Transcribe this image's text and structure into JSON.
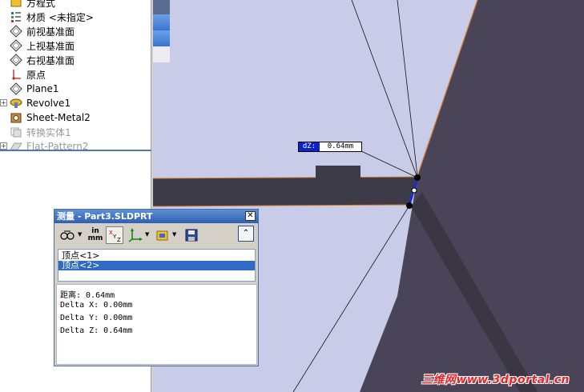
{
  "feature_tree": {
    "items": [
      {
        "label": "方程式",
        "icon": "equation-folder-icon",
        "expander": false,
        "dim": false
      },
      {
        "label": "材质 <未指定>",
        "icon": "material-icon",
        "expander": false,
        "dim": false
      },
      {
        "label": "前视基准面",
        "icon": "plane-icon",
        "expander": false,
        "dim": false
      },
      {
        "label": "上视基准面",
        "icon": "plane-icon",
        "expander": false,
        "dim": false
      },
      {
        "label": "右视基准面",
        "icon": "plane-icon",
        "expander": false,
        "dim": false
      },
      {
        "label": "原点",
        "icon": "origin-icon",
        "expander": false,
        "dim": false
      },
      {
        "label": "Plane1",
        "icon": "plane-icon",
        "expander": false,
        "dim": false
      },
      {
        "label": "Revolve1",
        "icon": "revolve-icon",
        "expander": true,
        "dim": false
      },
      {
        "label": "Sheet-Metal2",
        "icon": "sheet-metal-icon",
        "expander": false,
        "dim": false
      },
      {
        "label": "转换实体1",
        "icon": "convert-entity-icon",
        "expander": false,
        "dim": true
      },
      {
        "label": "Flat-Pattern2",
        "icon": "flat-pattern-icon",
        "expander": true,
        "dim": true
      }
    ]
  },
  "viewport": {
    "dimension_name": "dZ:",
    "dimension_value": "0.64mm",
    "background_color": "#c8cce8",
    "body_color": "#4a4458",
    "edge_color": "#d87b2a"
  },
  "measure_dialog": {
    "title": "测量 - Part3.SLDPRT",
    "close_label": "✕",
    "toolbar": {
      "units_top": "in",
      "units_bottom": "mm",
      "xyz_label": "XYZ",
      "collapse_label": "⌃"
    },
    "selections": [
      "顶点<1>",
      "顶点<2>"
    ],
    "selected_index": 1,
    "results": [
      "距离: 0.64mm",
      "Delta X: 0.00mm",
      "Delta Y: 0.00mm",
      "Delta Z: 0.64mm"
    ]
  },
  "watermark": "三维网www.3dportal.cn"
}
